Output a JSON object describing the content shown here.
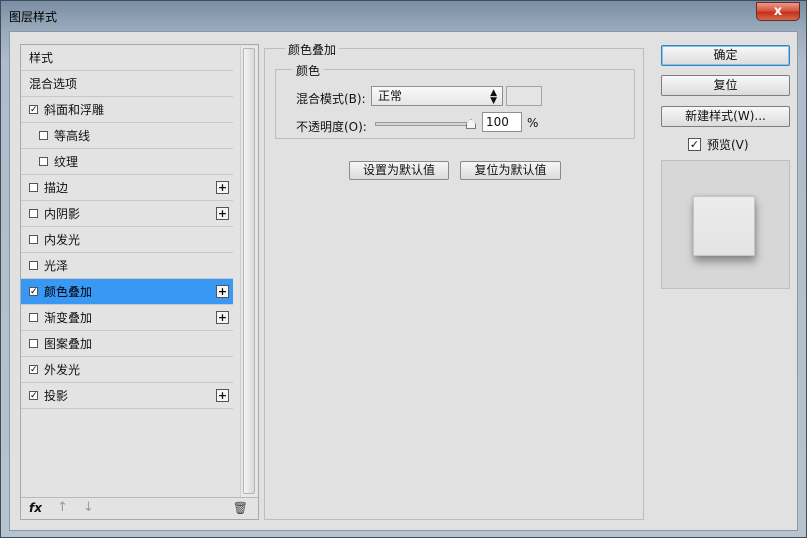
{
  "window": {
    "title": "图层样式",
    "close_label": "x"
  },
  "styles_list": {
    "items": [
      {
        "label": "样式",
        "checkbox": false,
        "checked": false,
        "plus": false,
        "indent": false,
        "selected": false
      },
      {
        "label": "混合选项",
        "checkbox": false,
        "checked": false,
        "plus": false,
        "indent": false,
        "selected": false
      },
      {
        "label": "斜面和浮雕",
        "checkbox": true,
        "checked": true,
        "plus": false,
        "indent": false,
        "selected": false
      },
      {
        "label": "等高线",
        "checkbox": true,
        "checked": false,
        "plus": false,
        "indent": true,
        "selected": false
      },
      {
        "label": "纹理",
        "checkbox": true,
        "checked": false,
        "plus": false,
        "indent": true,
        "selected": false
      },
      {
        "label": "描边",
        "checkbox": true,
        "checked": false,
        "plus": true,
        "indent": false,
        "selected": false
      },
      {
        "label": "内阴影",
        "checkbox": true,
        "checked": false,
        "plus": true,
        "indent": false,
        "selected": false
      },
      {
        "label": "内发光",
        "checkbox": true,
        "checked": false,
        "plus": false,
        "indent": false,
        "selected": false
      },
      {
        "label": "光泽",
        "checkbox": true,
        "checked": false,
        "plus": false,
        "indent": false,
        "selected": false
      },
      {
        "label": "颜色叠加",
        "checkbox": true,
        "checked": true,
        "plus": true,
        "indent": false,
        "selected": true
      },
      {
        "label": "渐变叠加",
        "checkbox": true,
        "checked": false,
        "plus": true,
        "indent": false,
        "selected": false
      },
      {
        "label": "图案叠加",
        "checkbox": true,
        "checked": false,
        "plus": false,
        "indent": false,
        "selected": false
      },
      {
        "label": "外发光",
        "checkbox": true,
        "checked": true,
        "plus": false,
        "indent": false,
        "selected": false
      },
      {
        "label": "投影",
        "checkbox": true,
        "checked": true,
        "plus": true,
        "indent": false,
        "selected": false
      }
    ],
    "footer": {
      "fx_label": "fx",
      "up_icon": "↑",
      "down_icon": "↓",
      "trash_icon": "🗑"
    }
  },
  "color_overlay": {
    "group_title": "颜色叠加",
    "sub_title": "颜色",
    "blend_mode_label": "混合模式(B):",
    "blend_mode_value": "正常",
    "opacity_label": "不透明度(O):",
    "opacity_value": "100",
    "opacity_unit": "%",
    "opacity_level": 1.0,
    "set_default_label": "设置为默认值",
    "reset_default_label": "复位为默认值"
  },
  "actions": {
    "ok_label": "确定",
    "reset_label": "复位",
    "new_style_label": "新建样式(W)...",
    "preview_label": "预览(V)",
    "preview_checked": true
  },
  "colors": {
    "selected_row": "#3a98f5",
    "close_button": "#c2321c"
  }
}
